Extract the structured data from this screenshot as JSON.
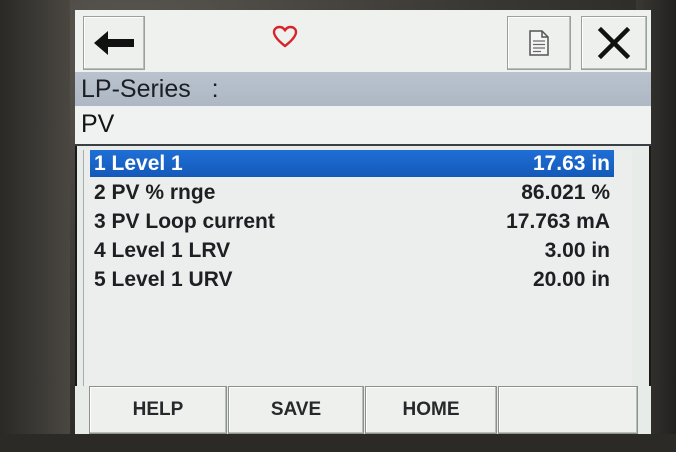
{
  "toolbar": {
    "back_icon": "arrow-left-icon",
    "status_icon": "heart-icon",
    "status_color": "#d8232a",
    "doc_icon": "document-icon",
    "close_icon": "close-icon"
  },
  "device": {
    "name": "LP-Series   :"
  },
  "path": {
    "label": "PV"
  },
  "menu": {
    "selected_index": 0,
    "items": [
      {
        "label": "1 Level 1",
        "value": "17.63 in"
      },
      {
        "label": "2 PV % rnge",
        "value": "86.021 %"
      },
      {
        "label": "3 PV Loop current",
        "value": "17.763 mA"
      },
      {
        "label": "4 Level 1 LRV",
        "value": "3.00 in"
      },
      {
        "label": "5 Level 1 URV",
        "value": "20.00 in"
      }
    ]
  },
  "buttons": {
    "help": "HELP",
    "save": "SAVE",
    "home": "HOME",
    "blank": ""
  },
  "colors": {
    "selection": "#1a63c8",
    "header_bar": "#b3bdc8"
  }
}
